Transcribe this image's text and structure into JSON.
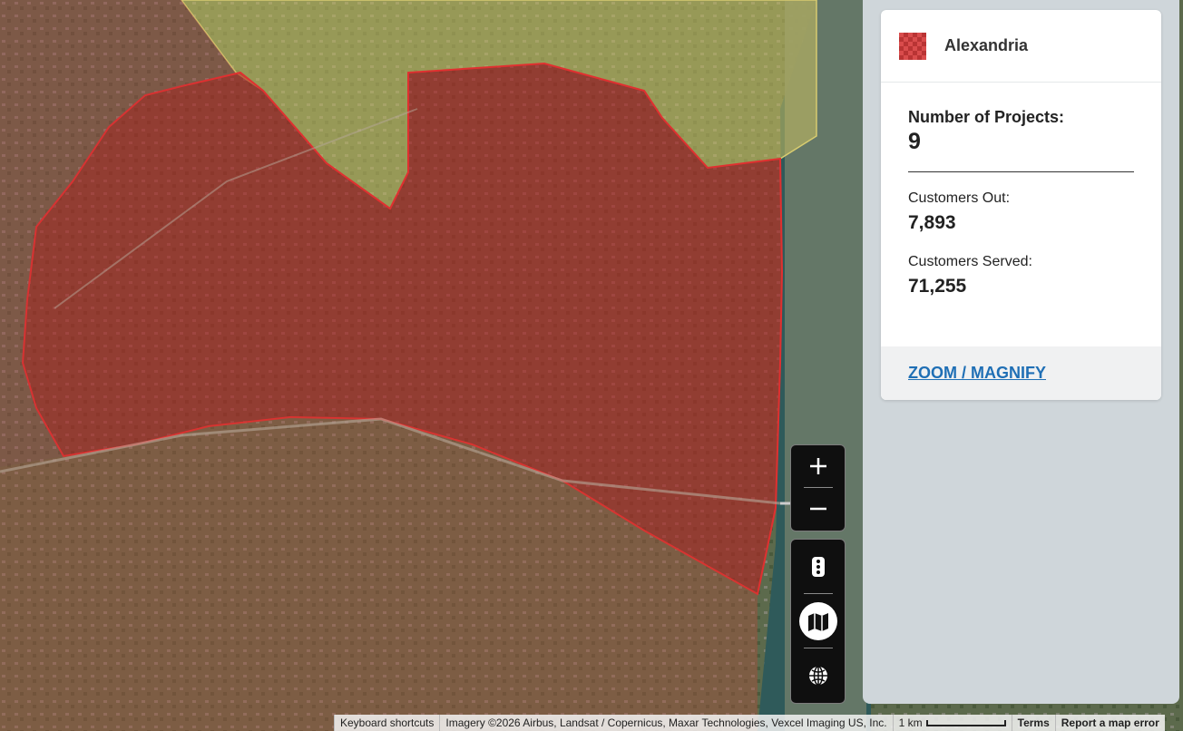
{
  "panel": {
    "title": "Alexandria",
    "swatch_color": "#d94c4c",
    "projects_label": "Number of Projects:",
    "projects_value": "9",
    "customers_out_label": "Customers Out:",
    "customers_out_value": "7,893",
    "customers_served_label": "Customers Served:",
    "customers_served_value": "71,255",
    "zoom_link": "ZOOM / MAGNIFY"
  },
  "map_controls": {
    "zoom_in": "+",
    "zoom_out": "−"
  },
  "attribution": {
    "keyboard": "Keyboard shortcuts",
    "imagery": "Imagery ©2026 Airbus, Landsat / Copernicus, Maxar Technologies, Vexcel Imaging US, Inc.",
    "scale": "1 km",
    "terms": "Terms",
    "report": "Report a map error"
  },
  "colors": {
    "region_fill": "#b32222",
    "neighbor_fill": "#c8c060",
    "river": "#2f5a5a"
  },
  "icons": [
    "plus-icon",
    "minus-icon",
    "traffic-light-icon",
    "map-icon",
    "globe-icon"
  ]
}
